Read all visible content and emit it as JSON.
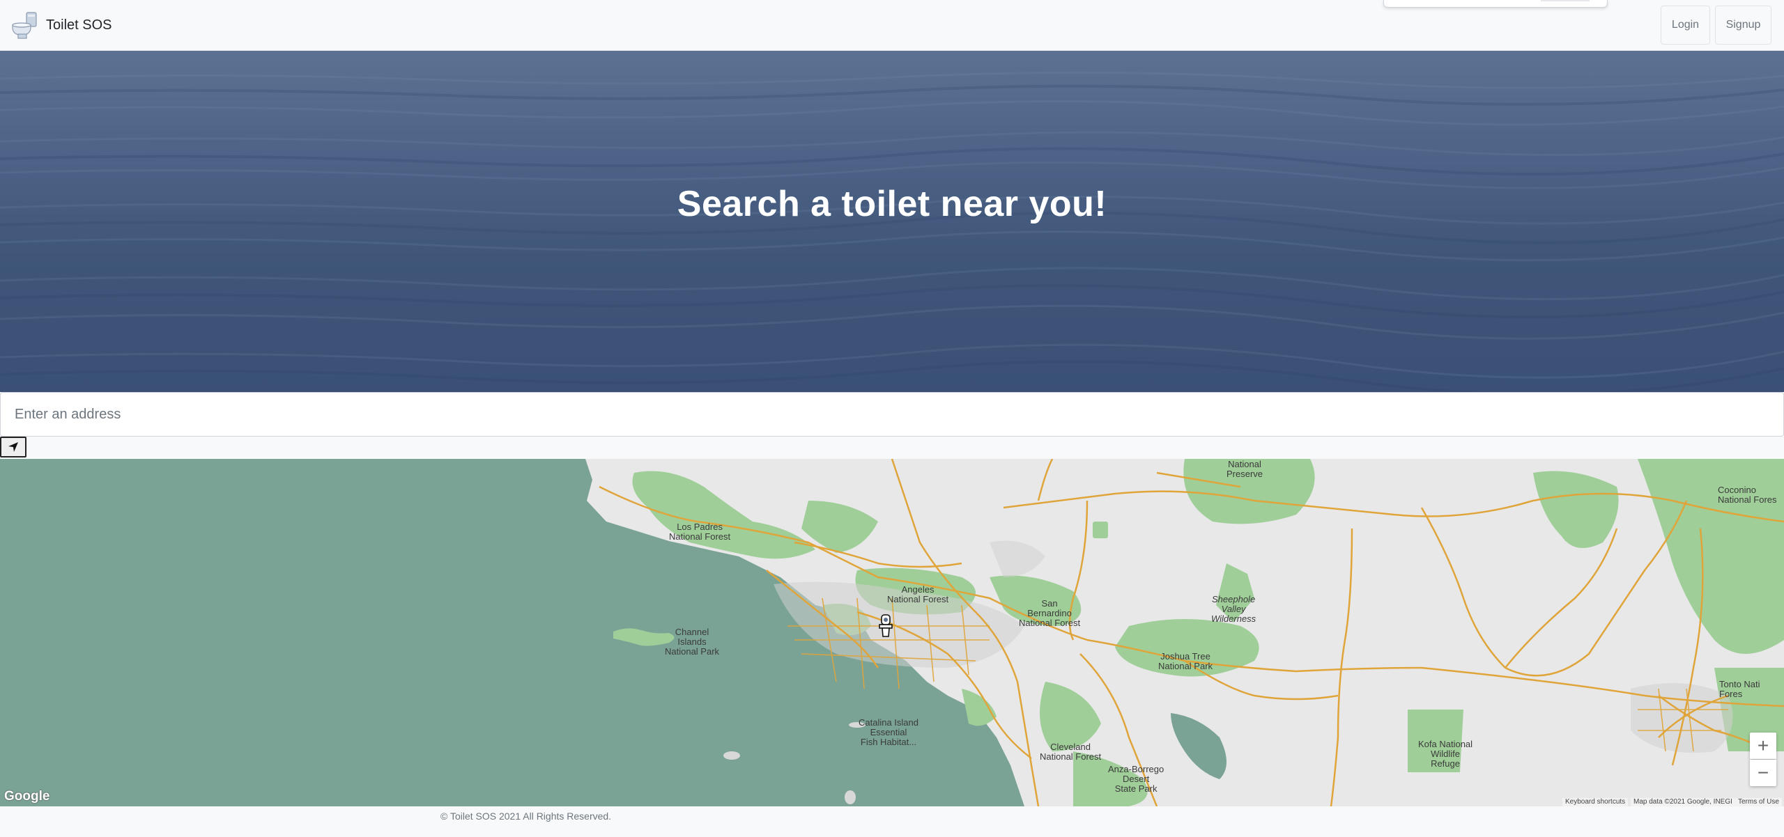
{
  "navbar": {
    "brand_name": "Toilet SOS",
    "brand_icon": "toilet-icon",
    "login_label": "Login",
    "signup_label": "Signup"
  },
  "hero": {
    "title": "Search a toilet near you!"
  },
  "search": {
    "placeholder": "Enter an address",
    "value": "",
    "locate_icon": "navigation-arrow-icon"
  },
  "map": {
    "labels": {
      "los_padres": "Los Padres\nNational Forest",
      "angeles": "Angeles\nNational Forest",
      "san_bernardino": "San\nBernardino\nNational Forest",
      "channel_islands": "Channel\nIslands\nNational Park",
      "joshua_tree": "Joshua Tree\nNational Park",
      "sheephole": "Sheephole\nValley\nWilderness",
      "national_preserve": "National\nPreserve",
      "coconino": "Coconino\nNational Fores",
      "tonto": "Tonto Nati\nFores",
      "kofa": "Kofa National\nWildlife\nRefuge",
      "cleveland": "Cleveland\nNational Forest",
      "anza_borrego": "Anza-Borrego\nDesert\nState Park",
      "catalina": "Catalina Island\nEssential\nFish Habitat..."
    },
    "zoom_in_label": "+",
    "zoom_out_label": "−",
    "google_logo": "Google",
    "keyboard_shortcuts": "Keyboard shortcuts",
    "map_data": "Map data ©2021 Google, INEGI",
    "terms": "Terms of Use",
    "marker_icon": "toilet-marker-icon"
  },
  "footer": {
    "copyright": "© Toilet SOS 2021 All Rights Reserved."
  },
  "colors": {
    "water": "#7aa396",
    "land": "#e8e8e8",
    "park": "#9fce98",
    "road": "#e0a53a",
    "hero_sea": "#4d6387"
  }
}
